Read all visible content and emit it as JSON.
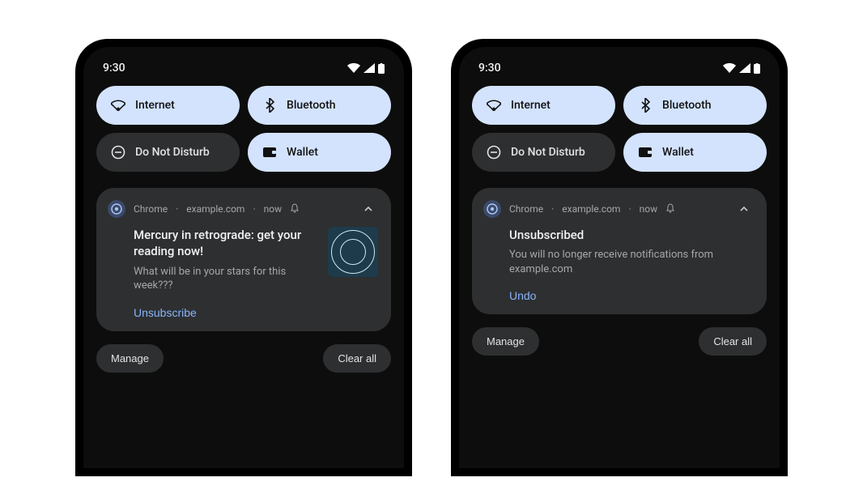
{
  "status": {
    "time": "9:30"
  },
  "qs": {
    "internet": "Internet",
    "bluetooth": "Bluetooth",
    "dnd": "Do Not Disturb",
    "wallet": "Wallet"
  },
  "notif_meta": {
    "app": "Chrome",
    "site": "example.com",
    "when": "now"
  },
  "left_notif": {
    "title": "Mercury in retrograde: get your reading now!",
    "body": "What will be in your stars for this week???",
    "action": "Unsubscribe"
  },
  "right_notif": {
    "title": "Unsubscribed",
    "body": "You will no longer receive notifications from example.com",
    "action": "Undo"
  },
  "footer": {
    "manage": "Manage",
    "clear": "Clear all"
  }
}
